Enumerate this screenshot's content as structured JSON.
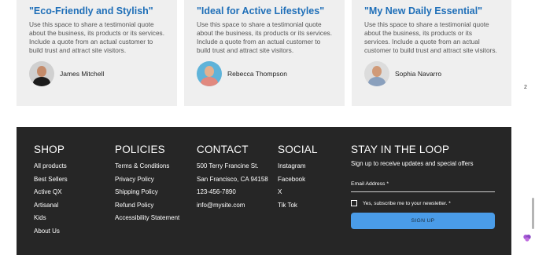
{
  "testimonials": [
    {
      "title": "\"Eco-Friendly and Stylish\"",
      "body": "Use this space to share a testimonial quote about the business, its products or its services. Include a quote from an actual customer to build trust and attract site visitors.",
      "name": "James Mitchell",
      "skin": "#c48b6a",
      "shirt": "#1c1c1c",
      "bg": "#d0d0d0"
    },
    {
      "title": "\"Ideal for Active Lifestyles\"",
      "body": "Use this space to share a testimonial quote about the business, its products or its services. Include a quote from an actual customer to build trust and attract site visitors.",
      "name": "Rebecca Thompson",
      "skin": "#e2b08f",
      "shirt": "#e1897f",
      "bg": "#5fb3d9"
    },
    {
      "title": "\"My New Daily Essential\"",
      "body": "Use this space to share a testimonial quote about the business, its products or its services. Include a quote from an actual customer to build trust and attract site visitors.",
      "name": "Sophia Navarro",
      "skin": "#d09a78",
      "shirt": "#8aa0bd",
      "bg": "#dcdcdc"
    }
  ],
  "scroll_mark": "2",
  "footer": {
    "shop": {
      "title": "Shop",
      "items": [
        "All products",
        "Best Sellers",
        "Active QX",
        "Artisanal",
        "Kids",
        "About Us"
      ]
    },
    "policies": {
      "title": "Policies",
      "items": [
        "Terms & Conditions",
        "Privacy Policy",
        "Shipping Policy",
        "Refund Policy",
        "Accessibility Statement"
      ]
    },
    "contact": {
      "title": "Contact",
      "items": [
        "500 Terry Francine St.",
        "San Francisco, CA 94158",
        "123-456-7890",
        "info@mysite.com"
      ]
    },
    "social": {
      "title": "Social",
      "items": [
        "Instagram",
        "Facebook",
        "X",
        "Tik Tok"
      ]
    },
    "loop": {
      "title": "Stay in the Loop",
      "subtitle": "Sign up to receive updates and special offers",
      "email_label": "Email Address *",
      "consent_label": "Yes, subscribe me to your newsletter. *",
      "button_label": "SIGN UP"
    }
  },
  "colors": {
    "accent": "#1f6fb8",
    "footer_bg": "#262626",
    "button": "#4a9ce8"
  }
}
